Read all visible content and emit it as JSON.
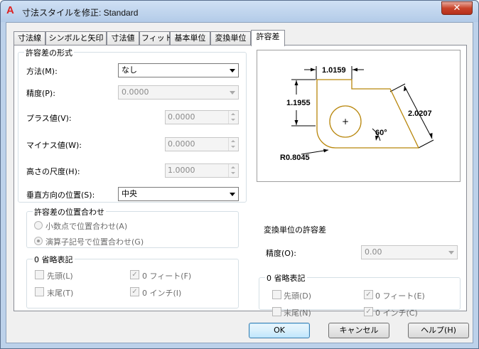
{
  "window": {
    "title": "寸法スタイルを修正: Standard",
    "app_icon": "A",
    "close_label": "✕"
  },
  "tabs": [
    {
      "label": "寸法線"
    },
    {
      "label": "シンボルと矢印"
    },
    {
      "label": "寸法値"
    },
    {
      "label": "フィット"
    },
    {
      "label": "基本単位"
    },
    {
      "label": "変換単位"
    },
    {
      "label": "許容差",
      "active": true
    }
  ],
  "tolerance_format": {
    "legend": "許容差の形式",
    "method_label": "方法(M):",
    "method_value": "なし",
    "precision_label": "精度(P):",
    "precision_value": "0.0000",
    "upper_label": "プラス値(V):",
    "upper_value": "0.0000",
    "lower_label": "マイナス値(W):",
    "lower_value": "0.0000",
    "height_label": "高さの尺度(H):",
    "height_value": "1.0000",
    "vertical_label": "垂直方向の位置(S):",
    "vertical_value": "中央"
  },
  "alignment": {
    "legend": "許容差の位置合わせ",
    "opt_decimal": "小数点で位置合わせ(A)",
    "opt_operator": "演算子記号で位置合わせ(G)"
  },
  "zero_suppress": {
    "legend": "0 省略表記",
    "leading": "先頭(L)",
    "trailing": "末尾(T)",
    "feet": "0 フィート(F)",
    "inches": "0 インチ(I)"
  },
  "alt_tolerance": {
    "legend": "変換単位の許容差",
    "precision_label": "精度(O):",
    "precision_value": "0.00"
  },
  "alt_zero_suppress": {
    "legend": "0 省略表記",
    "leading": "先頭(D)",
    "trailing": "末尾(N)",
    "feet": "0 フィート(E)",
    "inches": "0 インチ(C)"
  },
  "preview": {
    "dim_top": "1.0159",
    "dim_left": "1.1955",
    "dim_diag": "2.0207",
    "dim_angle": "60°",
    "dim_radius": "R0.8045",
    "centermark": "+"
  },
  "footer": {
    "ok": "OK",
    "cancel": "キャンセル",
    "help": "ヘルプ(H)"
  }
}
